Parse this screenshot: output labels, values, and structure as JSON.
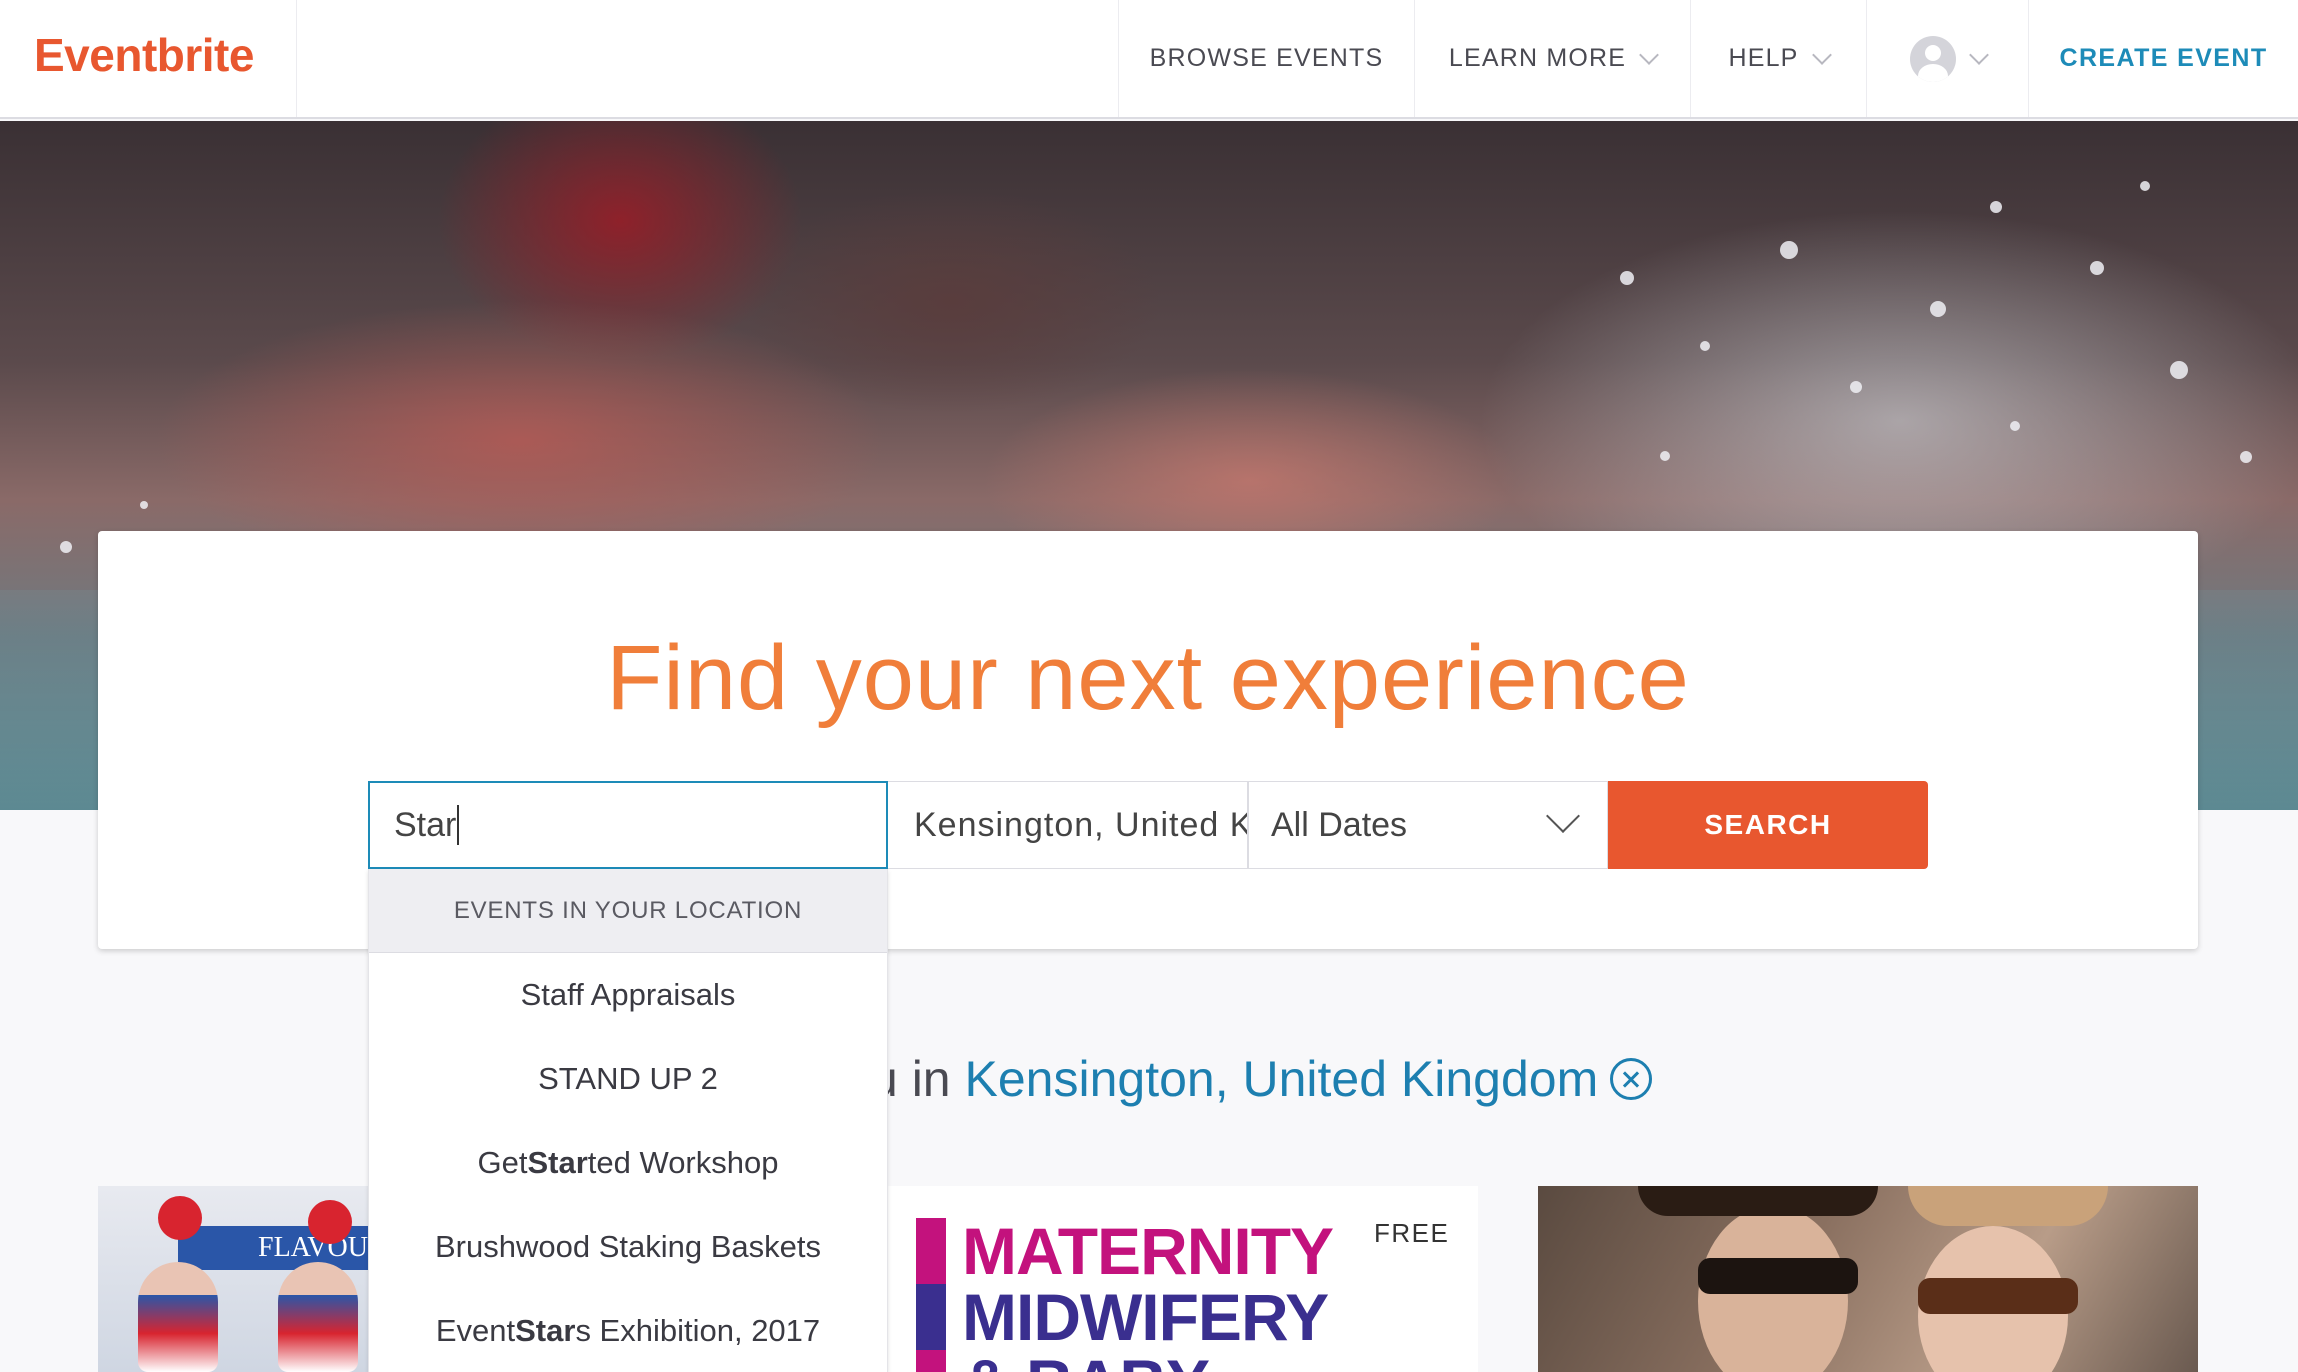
{
  "header": {
    "logo": "Eventbrite",
    "nav": {
      "browse": "BROWSE EVENTS",
      "learn_more": "LEARN MORE",
      "help": "HELP"
    },
    "create_event": "CREATE EVENT"
  },
  "search": {
    "headline": "Find your next experience",
    "query": "Star",
    "location": "Kensington, United Kingdom",
    "date": "All Dates",
    "button": "SEARCH"
  },
  "suggestions": {
    "header": "EVENTS IN YOUR LOCATION",
    "items": [
      {
        "before": "Staff Appraisals",
        "match": "",
        "after": ""
      },
      {
        "before": "STAND UP 2",
        "match": "",
        "after": ""
      },
      {
        "before": "Get ",
        "match": "Star",
        "after": "ted Workshop"
      },
      {
        "before": "Brushwood Staking Baskets",
        "match": "",
        "after": ""
      },
      {
        "before": "Event ",
        "match": "Star",
        "after": "s Exhibition, 2017"
      }
    ]
  },
  "results": {
    "prefix_visible": "u in ",
    "location": "Kensington, United Kingdom"
  },
  "events": {
    "card1_banner": "FLAVOUR",
    "card2_line1": "MATERNITY",
    "card2_line2": "MIDWIFERY",
    "card2_line3": "& BABY",
    "card2_price": "FREE"
  },
  "colors": {
    "brand": "#e8572f",
    "link": "#1d8bb8",
    "headline": "#f07e3a"
  }
}
